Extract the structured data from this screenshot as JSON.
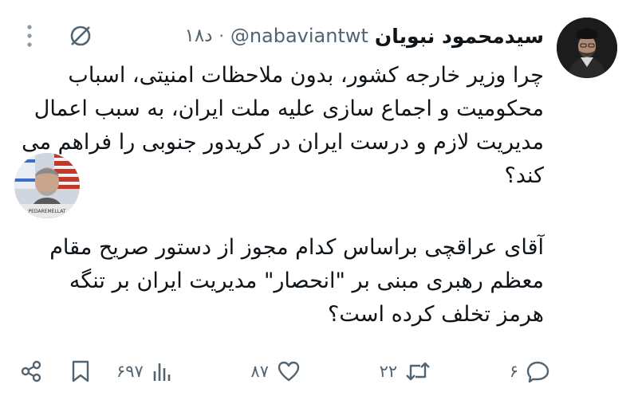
{
  "tweet": {
    "display_name": "سیدمحمود نبویان",
    "handle": "@nabaviantwt",
    "separator": "·",
    "time": "۱۸د",
    "paragraphs": [
      "چرا وزیر خارجه کشور، بدون ملاحظات امنیتی، اسباب محکومیت  و اجماع سازی علیه ملت ایران، به سبب اعمال مدیریت لازم و درست ایران در کریدور جنوبی را فراهم می کند؟",
      "آقای عراقچی براساس کدام مجوز از دستور صریح مقام معظم رهبری مبنی بر \"انحصار\" مدیریت ایران بر تنگه هرمز تخلف کرده است؟"
    ]
  },
  "actions": {
    "views": "۶۹۷",
    "likes": "۸۷",
    "retweets": "۲۲",
    "replies": "۶"
  },
  "sticker_caption": "PEDAREMELLAT",
  "icons": {
    "more": "more-vertical-icon",
    "grok": "grok-icon",
    "share": "share-icon",
    "bookmark": "bookmark-icon",
    "views": "views-icon",
    "like": "heart-icon",
    "retweet": "retweet-icon",
    "reply": "reply-icon"
  },
  "colors": {
    "text": "#0f1419",
    "secondary": "#536471",
    "background": "#ffffff"
  }
}
